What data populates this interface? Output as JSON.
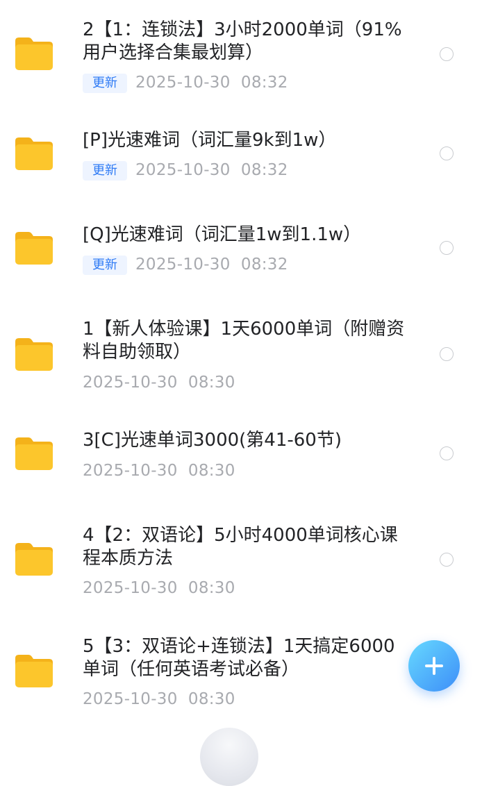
{
  "badge_label": "更新",
  "items": [
    {
      "title": "2【1：连锁法】3小时2000单词（91%用户选择合集最划算）",
      "date": "2025-10-30  08:32",
      "has_badge": true
    },
    {
      "title": "[P]光速难词（词汇量9k到1w）",
      "date": "2025-10-30  08:32",
      "has_badge": true
    },
    {
      "title": "[Q]光速难词（词汇量1w到1.1w）",
      "date": "2025-10-30  08:32",
      "has_badge": true
    },
    {
      "title": "1【新人体验课】1天6000单词（附赠资料自助领取）",
      "date": "2025-10-30  08:30",
      "has_badge": false
    },
    {
      "title": "3[C]光速单词3000(第41-60节)",
      "date": "2025-10-30  08:30",
      "has_badge": false
    },
    {
      "title": "4【2：双语论】5小时4000单词核心课程本质方法",
      "date": "2025-10-30  08:30",
      "has_badge": false
    },
    {
      "title": "5【3：双语论+连锁法】1天搞定6000单词（任何英语考试必备）",
      "date": "2025-10-30  08:30",
      "has_badge": false
    }
  ],
  "icons": {
    "folder": "folder-icon",
    "add": "add-icon",
    "radio": "radio-button"
  },
  "colors": {
    "accent": "#2f7bf5",
    "folder": "#fcc62c",
    "date_text": "#a8aaaf",
    "title_text": "#222326"
  }
}
